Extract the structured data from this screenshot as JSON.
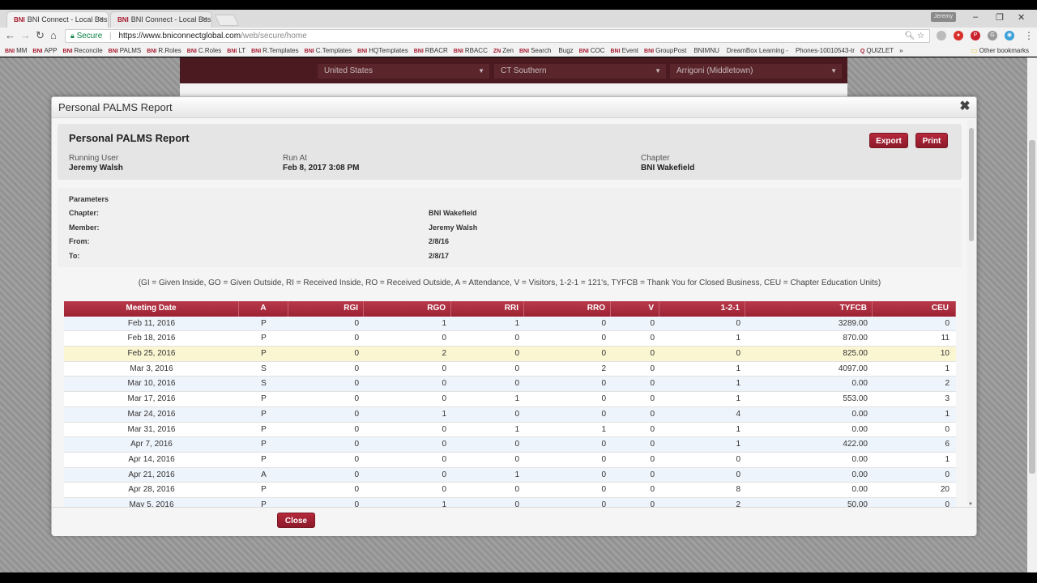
{
  "browser": {
    "tabs": [
      {
        "favicon": "BNI",
        "title": "BNI Connect - Local Busi",
        "active": true
      },
      {
        "favicon": "BNI",
        "title": "BNI Connect - Local Busi",
        "active": false
      }
    ],
    "profile": "Jeremy",
    "address": {
      "secure_label": "Secure",
      "url_main": "https://www.bniconnectglobal.com",
      "url_path": "/web/secure/home"
    },
    "bookmarks": [
      {
        "icon": "BNI",
        "label": "MM"
      },
      {
        "icon": "BNI",
        "label": "APP"
      },
      {
        "icon": "BNI",
        "label": "Reconcile"
      },
      {
        "icon": "BNI",
        "label": "PALMS"
      },
      {
        "icon": "BNI",
        "label": "R.Roles"
      },
      {
        "icon": "BNI",
        "label": "C.Roles"
      },
      {
        "icon": "BNI",
        "label": "LT"
      },
      {
        "icon": "BNI",
        "label": "R.Templates"
      },
      {
        "icon": "BNI",
        "label": "C.Templates"
      },
      {
        "icon": "BNI",
        "label": "HQTemplates"
      },
      {
        "icon": "BNI",
        "label": "RBACR"
      },
      {
        "icon": "BNI",
        "label": "RBACC"
      },
      {
        "icon": "ZN",
        "label": "Zen"
      },
      {
        "icon": "BNI",
        "label": "Search"
      },
      {
        "icon": "",
        "label": "Bugz"
      },
      {
        "icon": "BNI",
        "label": "COC"
      },
      {
        "icon": "BNI",
        "label": "Event"
      },
      {
        "icon": "BNI",
        "label": "GroupPost"
      },
      {
        "icon": "",
        "label": "BNIMNU"
      },
      {
        "icon": "",
        "label": "DreamBox Learning -"
      },
      {
        "icon": "",
        "label": "Phones-10010543-tr"
      },
      {
        "icon": "Q",
        "label": "QUIZLET"
      }
    ],
    "bookmarks_more": "»",
    "other_bookmarks": "Other bookmarks"
  },
  "page": {
    "selects": [
      "United States",
      "CT Southern",
      "Arrigoni (Middletown)"
    ]
  },
  "modal": {
    "title": "Personal PALMS Report",
    "report_title": "Personal PALMS Report",
    "export_label": "Export",
    "print_label": "Print",
    "running_user_label": "Running User",
    "running_user": "Jeremy Walsh",
    "run_at_label": "Run At",
    "run_at": "Feb 8, 2017 3:08 PM",
    "chapter_label": "Chapter",
    "chapter": "BNI Wakefield",
    "parameters_heading": "Parameters",
    "parameters": [
      {
        "label": "Chapter:",
        "value": "BNI Wakefield"
      },
      {
        "label": "Member:",
        "value": "Jeremy Walsh"
      },
      {
        "label": "From:",
        "value": "2/8/16"
      },
      {
        "label": "To:",
        "value": "2/8/17"
      }
    ],
    "legend": "(GI = Given Inside, GO = Given Outside, RI = Received Inside, RO = Received Outside, A = Attendance, V = Visitors, 1-2-1 = 121's, TYFCB = Thank You for Closed Business, CEU = Chapter Education Units)",
    "columns": [
      "Meeting Date",
      "A",
      "RGI",
      "RGO",
      "RRI",
      "RRO",
      "V",
      "1-2-1",
      "TYFCB",
      "CEU"
    ],
    "rows": [
      [
        "Feb 11, 2016",
        "P",
        "0",
        "1",
        "1",
        "0",
        "0",
        "0",
        "3289.00",
        "0"
      ],
      [
        "Feb 18, 2016",
        "P",
        "0",
        "0",
        "0",
        "0",
        "0",
        "1",
        "870.00",
        "11"
      ],
      [
        "Feb 25, 2016",
        "P",
        "0",
        "2",
        "0",
        "0",
        "0",
        "0",
        "825.00",
        "10"
      ],
      [
        "Mar 3, 2016",
        "S",
        "0",
        "0",
        "0",
        "2",
        "0",
        "1",
        "4097.00",
        "1"
      ],
      [
        "Mar 10, 2016",
        "S",
        "0",
        "0",
        "0",
        "0",
        "0",
        "1",
        "0.00",
        "2"
      ],
      [
        "Mar 17, 2016",
        "P",
        "0",
        "0",
        "1",
        "0",
        "0",
        "1",
        "553.00",
        "3"
      ],
      [
        "Mar 24, 2016",
        "P",
        "0",
        "1",
        "0",
        "0",
        "0",
        "4",
        "0.00",
        "1"
      ],
      [
        "Mar 31, 2016",
        "P",
        "0",
        "0",
        "1",
        "1",
        "0",
        "1",
        "0.00",
        "0"
      ],
      [
        "Apr 7, 2016",
        "P",
        "0",
        "0",
        "0",
        "0",
        "0",
        "1",
        "422.00",
        "6"
      ],
      [
        "Apr 14, 2016",
        "P",
        "0",
        "0",
        "0",
        "0",
        "0",
        "0",
        "0.00",
        "1"
      ],
      [
        "Apr 21, 2016",
        "A",
        "0",
        "0",
        "1",
        "0",
        "0",
        "0",
        "0.00",
        "0"
      ],
      [
        "Apr 28, 2016",
        "P",
        "0",
        "0",
        "0",
        "0",
        "0",
        "8",
        "0.00",
        "20"
      ],
      [
        "May 5, 2016",
        "P",
        "0",
        "1",
        "0",
        "0",
        "0",
        "2",
        "50.00",
        "0"
      ]
    ],
    "highlighted_row": 2,
    "close_label": "Close"
  },
  "colors": {
    "accent": "#a6192e",
    "header_bar": "#9b2233",
    "row_alt": "#eef4fb",
    "row_highlight": "#fbf6d2"
  }
}
